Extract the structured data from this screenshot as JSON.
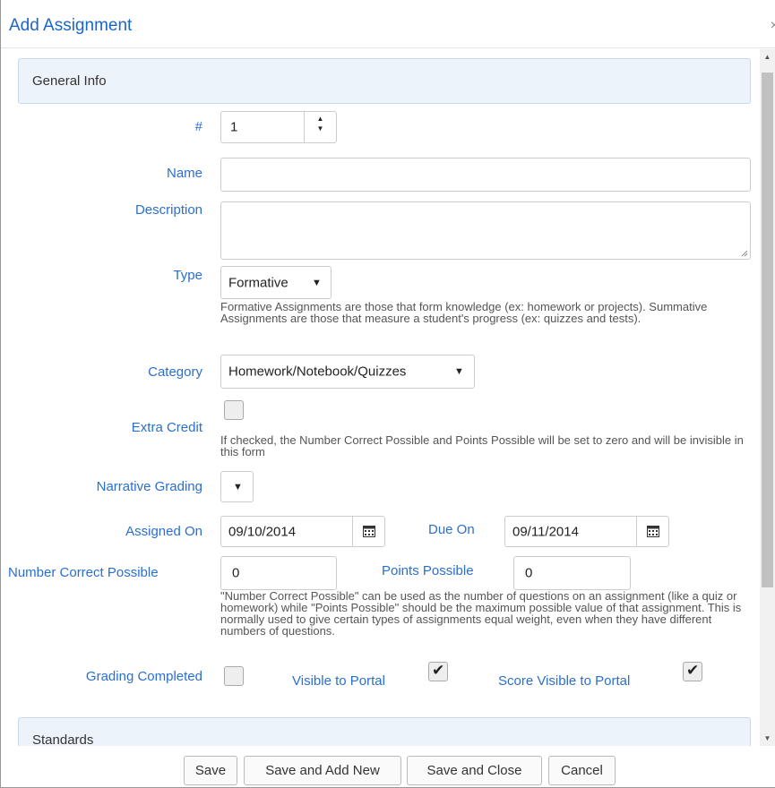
{
  "dialog": {
    "title": "Add Assignment",
    "close_glyph": "×"
  },
  "general_info": {
    "heading": "General Info"
  },
  "number": {
    "label": "#",
    "value": "1"
  },
  "name": {
    "label": "Name",
    "value": ""
  },
  "description": {
    "label": "Description",
    "value": ""
  },
  "type": {
    "label": "Type",
    "selected": "Formative",
    "help": "Formative Assignments are those that form knowledge (ex: homework or projects). Summative Assignments are those that measure a student's progress (ex: quizzes and tests)."
  },
  "category": {
    "label": "Category",
    "selected": "Homework/Notebook/Quizzes"
  },
  "extra_credit": {
    "label": "Extra Credit",
    "checked": false,
    "help": "If checked, the Number Correct Possible and Points Possible will be set to zero and will be invisible in this form"
  },
  "narrative_grading": {
    "label": "Narrative Grading",
    "selected": ""
  },
  "assigned_on": {
    "label": "Assigned On",
    "value": "09/10/2014"
  },
  "due_on": {
    "label": "Due On",
    "value": "09/11/2014"
  },
  "number_correct_possible": {
    "label": "Number Correct Possible",
    "value": "0"
  },
  "points_possible": {
    "label": "Points Possible",
    "value": "0",
    "help": "\"Number Correct Possible\" can be used as the number of questions on an assignment (like a quiz or homework) while \"Points Possible\" should be the maximum possible value of that assignment. This is normally used to give certain types of assignments equal weight, even when they have different numbers of questions."
  },
  "grading_completed": {
    "label": "Grading Completed",
    "checked": false
  },
  "visible_to_portal": {
    "label": "Visible to Portal",
    "checked": true
  },
  "score_visible_to_portal": {
    "label": "Score Visible to Portal",
    "checked": true
  },
  "standards": {
    "heading": "Standards"
  },
  "footer": {
    "save": "Save",
    "save_and_add_new": "Save and Add New",
    "save_and_close": "Save and Close",
    "cancel": "Cancel"
  },
  "icons": {
    "dropdown_arrow": "▼",
    "spin_up": "▲",
    "spin_down": "▼",
    "check": "✔"
  },
  "colors": {
    "accent": "#2a6fd0",
    "title": "#1b66c9",
    "panel_bg": "#edf3fa"
  }
}
